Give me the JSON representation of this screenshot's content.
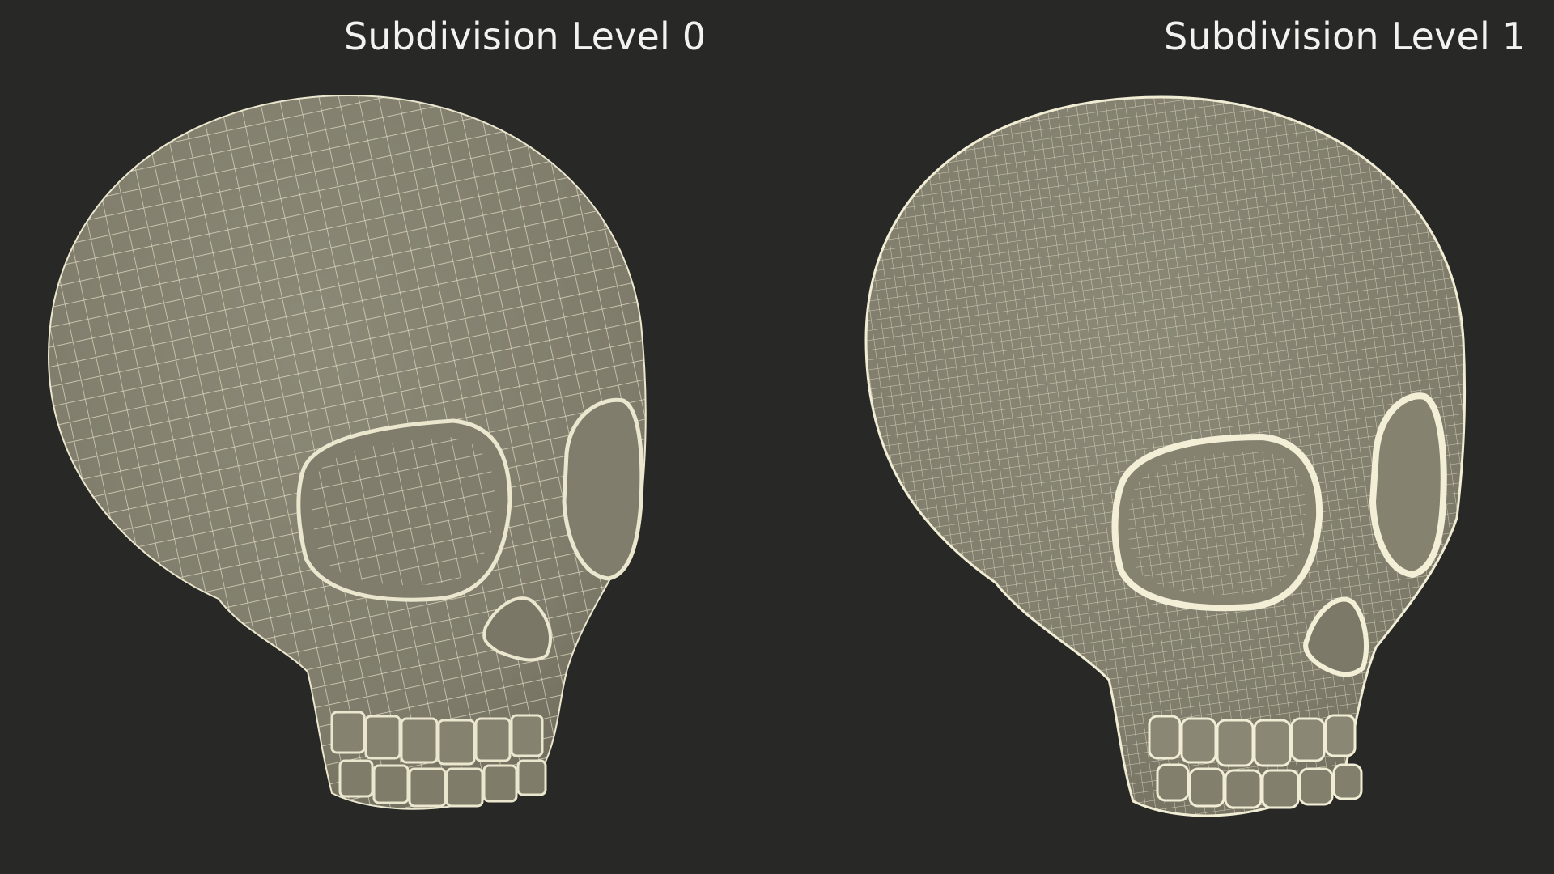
{
  "panels": [
    {
      "caption": "Subdivision Level 0",
      "subdivision_level": 0
    },
    {
      "caption": "Subdivision Level 1",
      "subdivision_level": 1
    }
  ],
  "colors": {
    "background": "#282827",
    "mesh_fill": "#8a8775",
    "wire": "#ebe7cf",
    "caption_text": "#f2f2ee"
  }
}
